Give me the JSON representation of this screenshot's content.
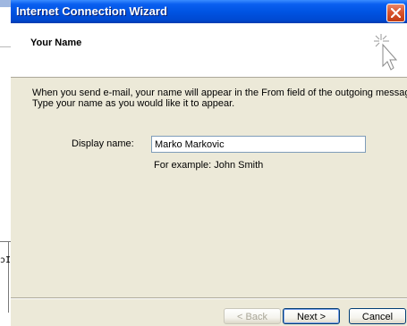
{
  "window": {
    "title": "Internet Connection Wizard"
  },
  "header": {
    "title": "Your Name",
    "icon": "wizard-wand-icon"
  },
  "intro": {
    "line1": "When you send e-mail, your name will appear in the From field of the outgoing message.",
    "line2": "Type your name as you would like it to appear."
  },
  "form": {
    "display_name_label": "Display name:",
    "display_name_value": "Marko Markovic",
    "example_text": "For example: John Smith"
  },
  "buttons": {
    "back": "< Back",
    "next": "Next >",
    "cancel": "Cancel"
  },
  "background": {
    "glyph": "ɔI"
  },
  "colors": {
    "titlebar": "#0054e3",
    "dialog_bg": "#ece9d8",
    "close_button": "#d9542e"
  }
}
